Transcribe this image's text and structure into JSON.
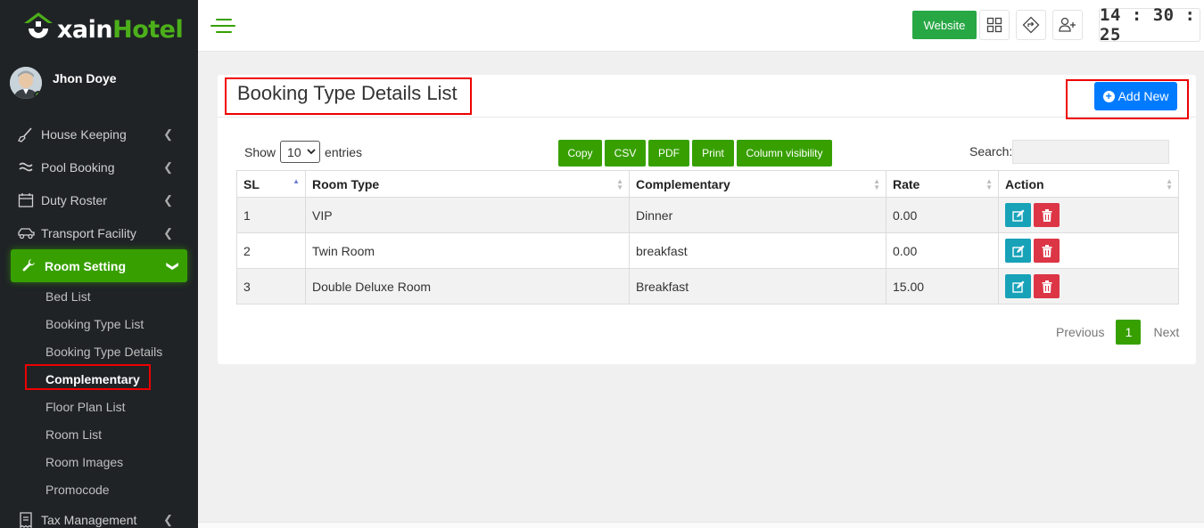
{
  "brand": {
    "prefix": "xain",
    "name": "Hotel"
  },
  "user": {
    "name": "Jhon Doye"
  },
  "sidebar": {
    "items": [
      {
        "label": "House Keeping",
        "icon": "broom-icon"
      },
      {
        "label": "Pool Booking",
        "icon": "water-icon"
      },
      {
        "label": "Duty Roster",
        "icon": "calendar-icon"
      },
      {
        "label": "Transport Facility",
        "icon": "car-icon"
      },
      {
        "label": "Room Setting",
        "icon": "wrench-icon"
      }
    ],
    "submenu": [
      "Bed List",
      "Booking Type List",
      "Booking Type Details",
      "Complementary",
      "Floor Plan List",
      "Room List",
      "Room Images",
      "Promocode"
    ],
    "last_item": {
      "label": "Tax Management",
      "icon": "receipt-icon"
    }
  },
  "topbar": {
    "website_label": "Website",
    "clock": "14 : 30 : 25"
  },
  "panel": {
    "title": "Booking Type Details List",
    "add_label": "Add New"
  },
  "controls": {
    "show_label": "Show",
    "entries_value": "10",
    "entries_label": "entries",
    "search_label": "Search:",
    "export_buttons": [
      "Copy",
      "CSV",
      "PDF",
      "Print",
      "Column visibility"
    ]
  },
  "table": {
    "columns": [
      "SL",
      "Room Type",
      "Complementary",
      "Rate",
      "Action"
    ],
    "rows": [
      {
        "sl": "1",
        "room_type": "VIP",
        "complementary": "Dinner",
        "rate": "0.00"
      },
      {
        "sl": "2",
        "room_type": "Twin Room",
        "complementary": "breakfast",
        "rate": "0.00"
      },
      {
        "sl": "3",
        "room_type": "Double Deluxe Room",
        "complementary": "Breakfast",
        "rate": "15.00"
      }
    ]
  },
  "pagination": {
    "previous": "Previous",
    "current": "1",
    "next": "Next"
  },
  "colors": {
    "accent_green": "#37a000",
    "primary_blue": "#007bff",
    "highlight_red": "#e00000",
    "sidebar_bg": "#1f2326"
  }
}
